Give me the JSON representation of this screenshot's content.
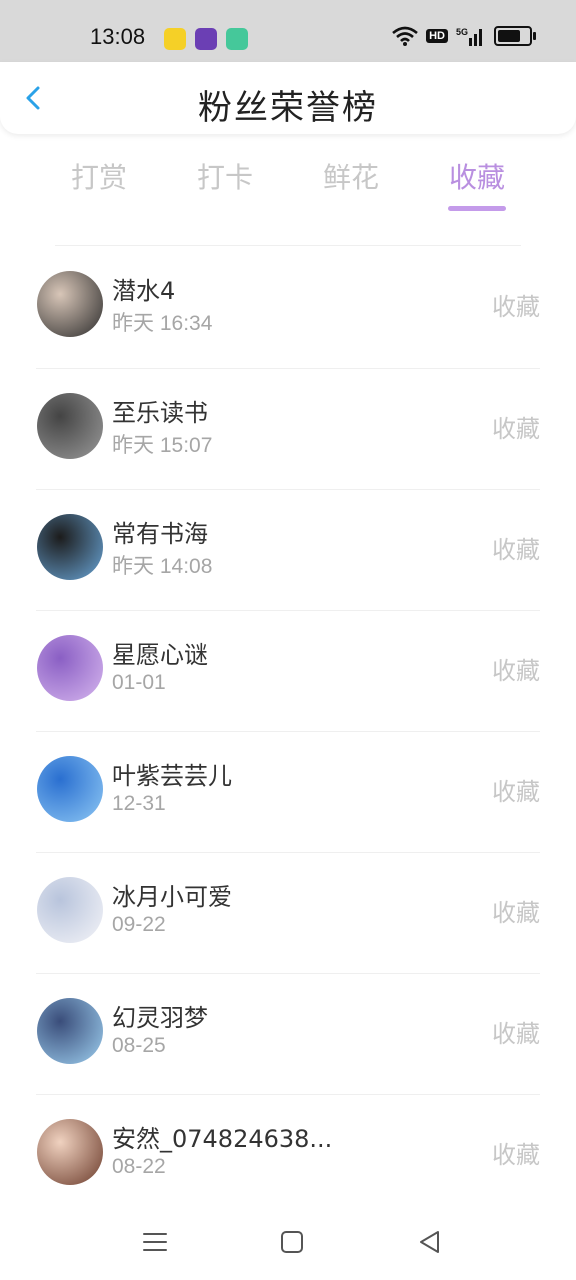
{
  "status_bar": {
    "time": "13:08",
    "apps": [
      {
        "icon": "chick-app-icon",
        "color": "#f5d027"
      },
      {
        "icon": "purple-circle-app-icon",
        "color": "#6b3fb4"
      },
      {
        "icon": "green-bag-app-icon",
        "color": "#45c89a"
      }
    ],
    "hd_label": "HD",
    "network": "5G",
    "battery_level": 0.85
  },
  "header": {
    "title": "粉丝荣誉榜",
    "back_icon": "chevron-left-icon",
    "accent": "#2aa2e8"
  },
  "tabs": [
    {
      "label": "打赏",
      "active": false
    },
    {
      "label": "打卡",
      "active": false
    },
    {
      "label": "鲜花",
      "active": false
    },
    {
      "label": "收藏",
      "active": true
    }
  ],
  "tab_accent": "#c49bea",
  "fans": [
    {
      "name": "潜水4",
      "date": "昨天 16:34",
      "action": "收藏",
      "avatar": "couple-photo",
      "colors": [
        "#2b2b2b",
        "#d8c6b8"
      ]
    },
    {
      "name": "至乐读书",
      "date": "昨天 15:07",
      "action": "收藏",
      "avatar": "grayscale-couple",
      "colors": [
        "#9a9a9a",
        "#444444"
      ]
    },
    {
      "name": "常有书海",
      "date": "昨天 14:08",
      "action": "收藏",
      "avatar": "beach-couple",
      "colors": [
        "#6aa6d8",
        "#1c1c1c"
      ]
    },
    {
      "name": "星愿心谜",
      "date": "01-01",
      "action": "收藏",
      "avatar": "purple-anime-girl",
      "colors": [
        "#d6b6ee",
        "#8a5fc4"
      ]
    },
    {
      "name": "叶紫芸芸儿",
      "date": "12-31",
      "action": "收藏",
      "avatar": "blue-anime-art",
      "colors": [
        "#8ec8f4",
        "#2a6fd0"
      ]
    },
    {
      "name": "冰月小可爱",
      "date": "09-22",
      "action": "收藏",
      "avatar": "white-anime-girl",
      "colors": [
        "#f4f4f8",
        "#b8c4dc"
      ]
    },
    {
      "name": "幻灵羽梦",
      "date": "08-25",
      "action": "收藏",
      "avatar": "scenic-anime",
      "colors": [
        "#9ed0f0",
        "#3a4d7a"
      ]
    },
    {
      "name": "安然_074824638...",
      "date": "08-22",
      "action": "收藏",
      "avatar": "brown-anime-boy",
      "colors": [
        "#6a3a2a",
        "#f0d2c0"
      ]
    }
  ],
  "nav": {
    "menu_icon": "menu-icon",
    "home_icon": "home-square-icon",
    "back_icon": "back-triangle-icon"
  }
}
